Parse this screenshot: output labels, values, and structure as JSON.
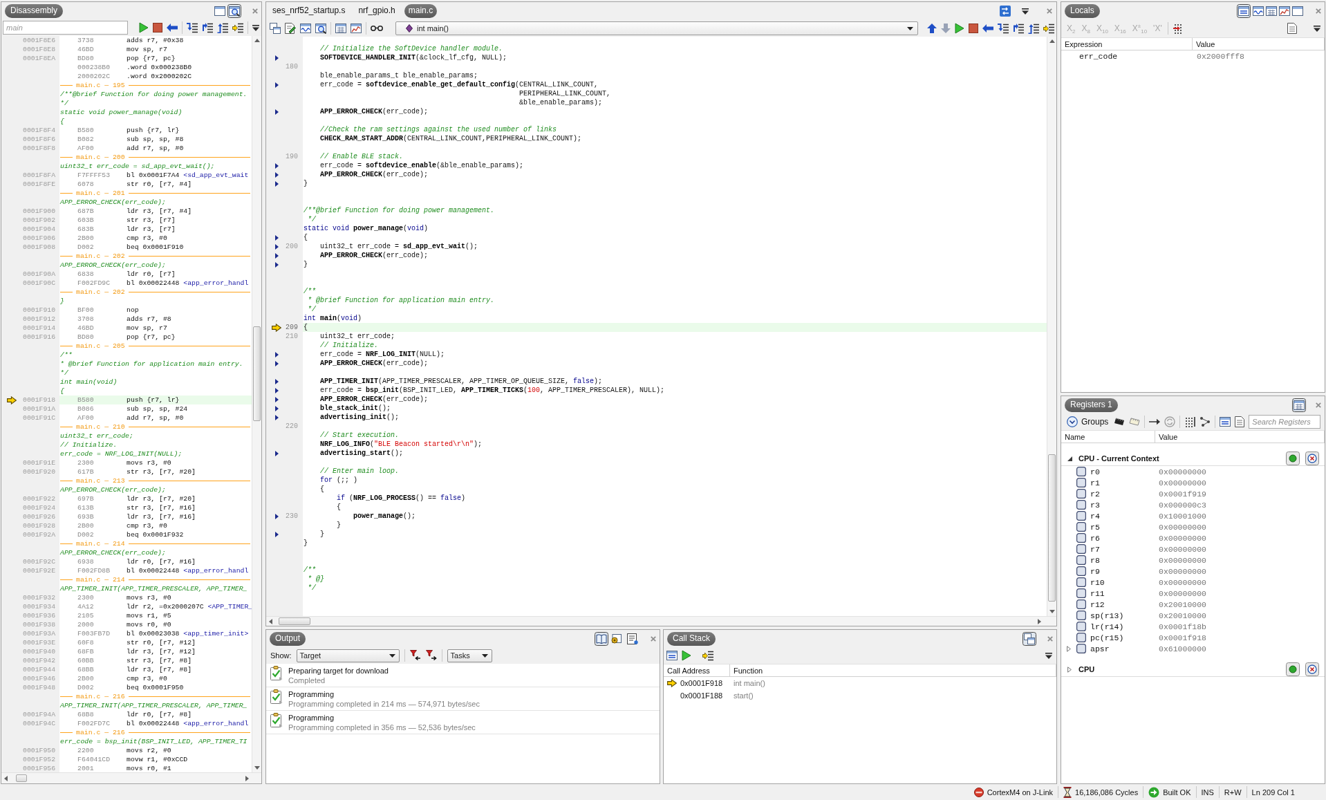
{
  "disassembly": {
    "title": "Disassembly",
    "location_field": {
      "placeholder": "main"
    },
    "rows": [
      {
        "kind": "instruction",
        "address": "0001F8E6",
        "opcode": "3738",
        "instruction": "adds r7, #0x38",
        "current": false
      },
      {
        "kind": "instruction",
        "address": "0001F8E8",
        "opcode": "46BD",
        "instruction": "mov sp, r7",
        "current": false
      },
      {
        "kind": "instruction",
        "address": "0001F8EA",
        "opcode": "BD80",
        "instruction": "pop {r7, pc}",
        "current": false
      },
      {
        "kind": "instruction",
        "opcode": "000238B0",
        "instruction": ".word 0x000238B0",
        "current": false
      },
      {
        "kind": "instruction",
        "opcode": "2000202C",
        "instruction": ".word 0x2000202C",
        "current": false
      },
      {
        "kind": "source_ref",
        "text": "main.c — 195"
      },
      {
        "kind": "source",
        "text": "/**@brief Function for doing power management."
      },
      {
        "kind": "source",
        "text": "*/"
      },
      {
        "kind": "source",
        "text": "static void power_manage(void)"
      },
      {
        "kind": "source",
        "text": "{"
      },
      {
        "kind": "instruction",
        "address": "0001F8F4",
        "opcode": "B580",
        "instruction": "push {r7, lr}",
        "current": false
      },
      {
        "kind": "instruction",
        "address": "0001F8F6",
        "opcode": "B082",
        "instruction": "sub sp, sp, #8",
        "current": false
      },
      {
        "kind": "instruction",
        "address": "0001F8F8",
        "opcode": "AF00",
        "instruction": "add r7, sp, #0",
        "current": false
      },
      {
        "kind": "source_ref",
        "text": "main.c — 200"
      },
      {
        "kind": "source",
        "text": "uint32_t err_code = sd_app_evt_wait();"
      },
      {
        "kind": "instruction",
        "address": "0001F8FA",
        "opcode": "F7FFFF53",
        "instruction": "bl 0x0001F7A4",
        "symbol": "<sd_app_evt_wait",
        "current": false
      },
      {
        "kind": "instruction",
        "address": "0001F8FE",
        "opcode": "6078",
        "instruction": "str r0, [r7, #4]",
        "current": false
      },
      {
        "kind": "source_ref",
        "text": "main.c — 201"
      },
      {
        "kind": "source",
        "text": "APP_ERROR_CHECK(err_code);"
      },
      {
        "kind": "instruction",
        "address": "0001F900",
        "opcode": "687B",
        "instruction": "ldr r3, [r7, #4]",
        "current": false
      },
      {
        "kind": "instruction",
        "address": "0001F902",
        "opcode": "603B",
        "instruction": "str r3, [r7]",
        "current": false
      },
      {
        "kind": "instruction",
        "address": "0001F904",
        "opcode": "683B",
        "instruction": "ldr r3, [r7]",
        "current": false
      },
      {
        "kind": "instruction",
        "address": "0001F906",
        "opcode": "2B00",
        "instruction": "cmp r3, #0",
        "current": false
      },
      {
        "kind": "instruction",
        "address": "0001F908",
        "opcode": "D002",
        "instruction": "beq 0x0001F910",
        "current": false
      },
      {
        "kind": "source_ref",
        "text": "main.c — 202"
      },
      {
        "kind": "source",
        "text": "APP_ERROR_CHECK(err_code);"
      },
      {
        "kind": "instruction",
        "address": "0001F90A",
        "opcode": "6838",
        "instruction": "ldr r0, [r7]",
        "current": false
      },
      {
        "kind": "instruction",
        "address": "0001F90C",
        "opcode": "F002FD9C",
        "instruction": "bl 0x00022448",
        "symbol": "<app_error_handl",
        "current": false
      },
      {
        "kind": "source_ref",
        "text": "main.c — 202"
      },
      {
        "kind": "source",
        "text": "}"
      },
      {
        "kind": "instruction",
        "address": "0001F910",
        "opcode": "BF00",
        "instruction": "nop",
        "current": false
      },
      {
        "kind": "instruction",
        "address": "0001F912",
        "opcode": "3708",
        "instruction": "adds r7, #8",
        "current": false
      },
      {
        "kind": "instruction",
        "address": "0001F914",
        "opcode": "46BD",
        "instruction": "mov sp, r7",
        "current": false
      },
      {
        "kind": "instruction",
        "address": "0001F916",
        "opcode": "BD80",
        "instruction": "pop {r7, pc}",
        "current": false
      },
      {
        "kind": "source_ref",
        "text": "main.c — 205"
      },
      {
        "kind": "source",
        "text": "/**"
      },
      {
        "kind": "source",
        "text": "* @brief Function for application main entry."
      },
      {
        "kind": "source",
        "text": "*/"
      },
      {
        "kind": "source",
        "text": "int main(void)"
      },
      {
        "kind": "source",
        "text": "{"
      },
      {
        "kind": "instruction",
        "address": "0001F918",
        "opcode": "B580",
        "instruction": "push {r7, lr}",
        "current": true
      },
      {
        "kind": "instruction",
        "address": "0001F91A",
        "opcode": "B086",
        "instruction": "sub sp, sp, #24",
        "current": false
      },
      {
        "kind": "instruction",
        "address": "0001F91C",
        "opcode": "AF00",
        "instruction": "add r7, sp, #0",
        "current": false
      },
      {
        "kind": "source_ref",
        "text": "main.c — 210"
      },
      {
        "kind": "source",
        "text": "uint32_t err_code;"
      },
      {
        "kind": "source",
        "text": "// Initialize."
      },
      {
        "kind": "source",
        "text": "err_code = NRF_LOG_INIT(NULL);"
      },
      {
        "kind": "instruction",
        "address": "0001F91E",
        "opcode": "2300",
        "instruction": "movs r3, #0",
        "current": false
      },
      {
        "kind": "instruction",
        "address": "0001F920",
        "opcode": "617B",
        "instruction": "str r3, [r7, #20]",
        "current": false
      },
      {
        "kind": "source_ref",
        "text": "main.c — 213"
      },
      {
        "kind": "source",
        "text": "APP_ERROR_CHECK(err_code);"
      },
      {
        "kind": "instruction",
        "address": "0001F922",
        "opcode": "697B",
        "instruction": "ldr r3, [r7, #20]",
        "current": false
      },
      {
        "kind": "instruction",
        "address": "0001F924",
        "opcode": "613B",
        "instruction": "str r3, [r7, #16]",
        "current": false
      },
      {
        "kind": "instruction",
        "address": "0001F926",
        "opcode": "693B",
        "instruction": "ldr r3, [r7, #16]",
        "current": false
      },
      {
        "kind": "instruction",
        "address": "0001F928",
        "opcode": "2B00",
        "instruction": "cmp r3, #0",
        "current": false
      },
      {
        "kind": "instruction",
        "address": "0001F92A",
        "opcode": "D002",
        "instruction": "beq 0x0001F932",
        "current": false
      },
      {
        "kind": "source_ref",
        "text": "main.c — 214"
      },
      {
        "kind": "source",
        "text": "APP_ERROR_CHECK(err_code);"
      },
      {
        "kind": "instruction",
        "address": "0001F92C",
        "opcode": "6938",
        "instruction": "ldr r0, [r7, #16]",
        "current": false
      },
      {
        "kind": "instruction",
        "address": "0001F92E",
        "opcode": "F002FD8B",
        "instruction": "bl 0x00022448",
        "symbol": "<app_error_handl",
        "current": false
      },
      {
        "kind": "source_ref",
        "text": "main.c — 214"
      },
      {
        "kind": "source",
        "text": "APP_TIMER_INIT(APP_TIMER_PRESCALER, APP_TIMER_"
      },
      {
        "kind": "instruction",
        "address": "0001F932",
        "opcode": "2300",
        "instruction": "movs r3, #0",
        "current": false
      },
      {
        "kind": "instruction",
        "address": "0001F934",
        "opcode": "4A12",
        "instruction": "ldr r2, =0x2000207C",
        "symbol": "<APP_TIMER_",
        "current": false
      },
      {
        "kind": "instruction",
        "address": "0001F936",
        "opcode": "2105",
        "instruction": "movs r1, #5",
        "current": false
      },
      {
        "kind": "instruction",
        "address": "0001F938",
        "opcode": "2000",
        "instruction": "movs r0, #0",
        "current": false
      },
      {
        "kind": "instruction",
        "address": "0001F93A",
        "opcode": "F003FB7D",
        "instruction": "bl 0x00023038",
        "symbol": "<app_timer_init>",
        "current": false
      },
      {
        "kind": "instruction",
        "address": "0001F93E",
        "opcode": "60F8",
        "instruction": "str r0, [r7, #12]",
        "current": false
      },
      {
        "kind": "instruction",
        "address": "0001F940",
        "opcode": "68FB",
        "instruction": "ldr r3, [r7, #12]",
        "current": false
      },
      {
        "kind": "instruction",
        "address": "0001F942",
        "opcode": "60BB",
        "instruction": "str r3, [r7, #8]",
        "current": false
      },
      {
        "kind": "instruction",
        "address": "0001F944",
        "opcode": "68BB",
        "instruction": "ldr r3, [r7, #8]",
        "current": false
      },
      {
        "kind": "instruction",
        "address": "0001F946",
        "opcode": "2B00",
        "instruction": "cmp r3, #0",
        "current": false
      },
      {
        "kind": "instruction",
        "address": "0001F948",
        "opcode": "D002",
        "instruction": "beq 0x0001F950",
        "current": false
      },
      {
        "kind": "source_ref",
        "text": "main.c — 216"
      },
      {
        "kind": "source",
        "text": "APP_TIMER_INIT(APP_TIMER_PRESCALER, APP_TIMER_"
      },
      {
        "kind": "instruction",
        "address": "0001F94A",
        "opcode": "68B8",
        "instruction": "ldr r0, [r7, #8]",
        "current": false
      },
      {
        "kind": "instruction",
        "address": "0001F94C",
        "opcode": "F002FD7C",
        "instruction": "bl 0x00022448",
        "symbol": "<app_error_handl",
        "current": false
      },
      {
        "kind": "source_ref",
        "text": "main.c — 216"
      },
      {
        "kind": "source",
        "text": "err_code = bsp_init(BSP_INIT_LED, APP_TIMER_TI"
      },
      {
        "kind": "instruction",
        "address": "0001F950",
        "opcode": "2200",
        "instruction": "movs r2, #0",
        "current": false
      },
      {
        "kind": "instruction",
        "address": "0001F952",
        "opcode": "F64041CD",
        "instruction": "movw r1, #0xCCD",
        "current": false
      },
      {
        "kind": "instruction",
        "address": "0001F956",
        "opcode": "2001",
        "instruction": "movs r0, #1",
        "current": false
      }
    ]
  },
  "editor": {
    "tabs": [
      {
        "label": "ses_nrf52_startup.s",
        "selected": false
      },
      {
        "label": "nrf_gpio.h",
        "selected": false
      },
      {
        "label": "main.c",
        "selected": true
      }
    ],
    "function_selector": {
      "value": "int main()"
    },
    "lines": [
      {
        "code_marker": false,
        "current": false,
        "parts": [
          {
            "kind": "comment",
            "text": "    // Initialize the SoftDevice handler module."
          }
        ]
      },
      {
        "code_marker": true,
        "current": false,
        "parts": [
          {
            "kind": "function",
            "text": "    SOFTDEVICE_HANDLER_INIT"
          },
          {
            "kind": "plain",
            "text": "(&clock_lf_cfg, NULL);"
          }
        ]
      },
      {
        "number": "180",
        "code_marker": false,
        "current": false
      },
      {
        "code_marker": false,
        "current": false,
        "parts": [
          {
            "kind": "plain",
            "text": "    ble_enable_params_t ble_enable_params;"
          }
        ]
      },
      {
        "code_marker": true,
        "current": false,
        "parts": [
          {
            "kind": "plain",
            "text": "    err_code = "
          },
          {
            "kind": "function",
            "text": "softdevice_enable_get_default_config"
          },
          {
            "kind": "plain",
            "text": "(CENTRAL_LINK_COUNT,"
          }
        ]
      },
      {
        "code_marker": false,
        "current": false,
        "parts": [
          {
            "kind": "plain",
            "text": "                                                    PERIPHERAL_LINK_COUNT,"
          }
        ]
      },
      {
        "code_marker": false,
        "current": false,
        "parts": [
          {
            "kind": "plain",
            "text": "                                                    &ble_enable_params);"
          }
        ]
      },
      {
        "code_marker": true,
        "current": false,
        "parts": [
          {
            "kind": "function",
            "text": "    APP_ERROR_CHECK"
          },
          {
            "kind": "plain",
            "text": "(err_code);"
          }
        ]
      },
      {
        "code_marker": false,
        "current": false
      },
      {
        "code_marker": false,
        "current": false,
        "parts": [
          {
            "kind": "comment",
            "text": "    //Check the ram settings against the used number of links"
          }
        ]
      },
      {
        "code_marker": false,
        "current": false,
        "parts": [
          {
            "kind": "function",
            "text": "    CHECK_RAM_START_ADDR"
          },
          {
            "kind": "plain",
            "text": "(CENTRAL_LINK_COUNT,PERIPHERAL_LINK_COUNT);"
          }
        ]
      },
      {
        "code_marker": false,
        "current": false
      },
      {
        "number": "190",
        "code_marker": false,
        "current": false,
        "parts": [
          {
            "kind": "comment",
            "text": "    // Enable BLE stack."
          }
        ]
      },
      {
        "code_marker": true,
        "current": false,
        "parts": [
          {
            "kind": "plain",
            "text": "    err_code = "
          },
          {
            "kind": "function",
            "text": "softdevice_enable"
          },
          {
            "kind": "plain",
            "text": "(&ble_enable_params);"
          }
        ]
      },
      {
        "code_marker": true,
        "current": false,
        "parts": [
          {
            "kind": "function",
            "text": "    APP_ERROR_CHECK"
          },
          {
            "kind": "plain",
            "text": "(err_code);"
          }
        ]
      },
      {
        "code_marker": true,
        "current": false,
        "parts": [
          {
            "kind": "plain",
            "text": "}"
          }
        ]
      },
      {
        "code_marker": false,
        "current": false
      },
      {
        "code_marker": false,
        "current": false
      },
      {
        "code_marker": false,
        "current": false,
        "parts": [
          {
            "kind": "comment",
            "text": "/**@brief Function for doing power management."
          }
        ]
      },
      {
        "code_marker": false,
        "current": false,
        "parts": [
          {
            "kind": "comment",
            "text": " */"
          }
        ]
      },
      {
        "code_marker": false,
        "current": false,
        "parts": [
          {
            "kind": "keyword",
            "text": "static void "
          },
          {
            "kind": "function",
            "text": "power_manage"
          },
          {
            "kind": "plain",
            "text": "("
          },
          {
            "kind": "keyword",
            "text": "void"
          },
          {
            "kind": "plain",
            "text": ")"
          }
        ]
      },
      {
        "code_marker": true,
        "current": false,
        "parts": [
          {
            "kind": "plain",
            "text": "{"
          }
        ]
      },
      {
        "number": "200",
        "code_marker": true,
        "current": false,
        "parts": [
          {
            "kind": "plain",
            "text": "    uint32_t err_code = "
          },
          {
            "kind": "function",
            "text": "sd_app_evt_wait"
          },
          {
            "kind": "plain",
            "text": "();"
          }
        ]
      },
      {
        "code_marker": true,
        "current": false,
        "parts": [
          {
            "kind": "function",
            "text": "    APP_ERROR_CHECK"
          },
          {
            "kind": "plain",
            "text": "(err_code);"
          }
        ]
      },
      {
        "code_marker": true,
        "current": false,
        "parts": [
          {
            "kind": "plain",
            "text": "}"
          }
        ]
      },
      {
        "code_marker": false,
        "current": false
      },
      {
        "code_marker": false,
        "current": false
      },
      {
        "code_marker": false,
        "current": false,
        "parts": [
          {
            "kind": "comment",
            "text": "/**"
          }
        ]
      },
      {
        "code_marker": false,
        "current": false,
        "parts": [
          {
            "kind": "comment",
            "text": " * @brief Function for application main entry."
          }
        ]
      },
      {
        "code_marker": false,
        "current": false,
        "parts": [
          {
            "kind": "comment",
            "text": " */"
          }
        ]
      },
      {
        "code_marker": false,
        "current": false,
        "parts": [
          {
            "kind": "keyword",
            "text": "int "
          },
          {
            "kind": "function",
            "text": "main"
          },
          {
            "kind": "plain",
            "text": "("
          },
          {
            "kind": "keyword",
            "text": "void"
          },
          {
            "kind": "plain",
            "text": ")"
          }
        ]
      },
      {
        "number": "209",
        "code_marker": false,
        "current": true,
        "parts": [
          {
            "kind": "plain",
            "text": "{"
          }
        ]
      },
      {
        "number": "210",
        "code_marker": false,
        "current": false,
        "parts": [
          {
            "kind": "plain",
            "text": "    uint32_t err_code;"
          }
        ]
      },
      {
        "code_marker": false,
        "current": false,
        "parts": [
          {
            "kind": "comment",
            "text": "    // Initialize."
          }
        ]
      },
      {
        "code_marker": true,
        "current": false,
        "parts": [
          {
            "kind": "plain",
            "text": "    err_code = "
          },
          {
            "kind": "function",
            "text": "NRF_LOG_INIT"
          },
          {
            "kind": "plain",
            "text": "(NULL);"
          }
        ]
      },
      {
        "code_marker": true,
        "current": false,
        "parts": [
          {
            "kind": "function",
            "text": "    APP_ERROR_CHECK"
          },
          {
            "kind": "plain",
            "text": "(err_code);"
          }
        ]
      },
      {
        "code_marker": false,
        "current": false
      },
      {
        "code_marker": true,
        "current": false,
        "parts": [
          {
            "kind": "function",
            "text": "    APP_TIMER_INIT"
          },
          {
            "kind": "plain",
            "text": "(APP_TIMER_PRESCALER, APP_TIMER_OP_QUEUE_SIZE, "
          },
          {
            "kind": "keyword",
            "text": "false"
          },
          {
            "kind": "plain",
            "text": ");"
          }
        ]
      },
      {
        "code_marker": true,
        "current": false,
        "parts": [
          {
            "kind": "plain",
            "text": "    err_code = "
          },
          {
            "kind": "function",
            "text": "bsp_init"
          },
          {
            "kind": "plain",
            "text": "(BSP_INIT_LED, "
          },
          {
            "kind": "function",
            "text": "APP_TIMER_TICKS"
          },
          {
            "kind": "plain",
            "text": "("
          },
          {
            "kind": "number",
            "text": "100"
          },
          {
            "kind": "plain",
            "text": ", APP_TIMER_PRESCALER), NULL);"
          }
        ]
      },
      {
        "code_marker": true,
        "current": false,
        "parts": [
          {
            "kind": "function",
            "text": "    APP_ERROR_CHECK"
          },
          {
            "kind": "plain",
            "text": "(err_code);"
          }
        ]
      },
      {
        "code_marker": true,
        "current": false,
        "parts": [
          {
            "kind": "function",
            "text": "    ble_stack_init"
          },
          {
            "kind": "plain",
            "text": "();"
          }
        ]
      },
      {
        "code_marker": true,
        "current": false,
        "parts": [
          {
            "kind": "function",
            "text": "    advertising_init"
          },
          {
            "kind": "plain",
            "text": "();"
          }
        ]
      },
      {
        "number": "220",
        "code_marker": false,
        "current": false
      },
      {
        "code_marker": false,
        "current": false,
        "parts": [
          {
            "kind": "comment",
            "text": "    // Start execution."
          }
        ]
      },
      {
        "code_marker": false,
        "current": false,
        "parts": [
          {
            "kind": "function",
            "text": "    NRF_LOG_INFO"
          },
          {
            "kind": "plain",
            "text": "("
          },
          {
            "kind": "string",
            "text": "\"BLE Beacon started\\r\\n\""
          },
          {
            "kind": "plain",
            "text": ");"
          }
        ]
      },
      {
        "code_marker": true,
        "current": false,
        "parts": [
          {
            "kind": "function",
            "text": "    advertising_start"
          },
          {
            "kind": "plain",
            "text": "();"
          }
        ]
      },
      {
        "code_marker": false,
        "current": false
      },
      {
        "code_marker": false,
        "current": false,
        "parts": [
          {
            "kind": "comment",
            "text": "    // Enter main loop."
          }
        ]
      },
      {
        "code_marker": false,
        "current": false,
        "parts": [
          {
            "kind": "keyword",
            "text": "    for"
          },
          {
            "kind": "plain",
            "text": " (;; )"
          }
        ]
      },
      {
        "code_marker": false,
        "current": false,
        "parts": [
          {
            "kind": "plain",
            "text": "    {"
          }
        ]
      },
      {
        "code_marker": false,
        "current": false,
        "parts": [
          {
            "kind": "keyword",
            "text": "        if"
          },
          {
            "kind": "plain",
            "text": " ("
          },
          {
            "kind": "function",
            "text": "NRF_LOG_PROCESS"
          },
          {
            "kind": "plain",
            "text": "() == "
          },
          {
            "kind": "keyword",
            "text": "false"
          },
          {
            "kind": "plain",
            "text": ")"
          }
        ]
      },
      {
        "code_marker": false,
        "current": false,
        "parts": [
          {
            "kind": "plain",
            "text": "        {"
          }
        ]
      },
      {
        "number": "230",
        "code_marker": true,
        "current": false,
        "parts": [
          {
            "kind": "function",
            "text": "            power_manage"
          },
          {
            "kind": "plain",
            "text": "();"
          }
        ]
      },
      {
        "code_marker": false,
        "current": false,
        "parts": [
          {
            "kind": "plain",
            "text": "        }"
          }
        ]
      },
      {
        "code_marker": true,
        "current": false,
        "parts": [
          {
            "kind": "plain",
            "text": "    }"
          }
        ]
      },
      {
        "code_marker": false,
        "current": false,
        "parts": [
          {
            "kind": "plain",
            "text": "}"
          }
        ]
      },
      {
        "code_marker": false,
        "current": false
      },
      {
        "code_marker": false,
        "current": false
      },
      {
        "code_marker": false,
        "current": false,
        "parts": [
          {
            "kind": "comment",
            "text": "/**"
          }
        ]
      },
      {
        "code_marker": false,
        "current": false,
        "parts": [
          {
            "kind": "comment",
            "text": " * @}"
          }
        ]
      },
      {
        "code_marker": false,
        "current": false,
        "parts": [
          {
            "kind": "comment",
            "text": " */"
          }
        ]
      }
    ]
  },
  "output": {
    "title": "Output",
    "show_label": "Show:",
    "show_select": {
      "value": "Target"
    },
    "tasks_select": {
      "value": "Tasks"
    },
    "entries": [
      {
        "title": "Preparing target for download",
        "detail": "Completed"
      },
      {
        "title": "Programming",
        "detail": "Programming completed in 214 ms — 574,971 bytes/sec"
      },
      {
        "title": "Programming",
        "detail": "Programming completed in 356 ms — 52,536 bytes/sec"
      }
    ]
  },
  "call_stack": {
    "title": "Call Stack",
    "columns": [
      "Call Address",
      "Function"
    ],
    "rows": [
      {
        "address": "0x0001F918",
        "function": "int main()",
        "current": true
      },
      {
        "address": "0x0001F188",
        "function": "start()",
        "current": false
      }
    ]
  },
  "locals": {
    "title": "Locals",
    "format_buttons": [
      {
        "label": "X$_{2}$",
        "disabled": true
      },
      {
        "label": "X$_{8}$",
        "disabled": true
      },
      {
        "label": "X$_{10}$",
        "disabled": true
      },
      {
        "label": "X$_{16}$",
        "disabled": true
      },
      {
        "label": "X$^{±}$$_{10}$",
        "disabled": true
      },
      {
        "label": "'X'",
        "disabled": true
      }
    ],
    "columns": [
      "Expression",
      "Value"
    ],
    "rows": [
      {
        "expression": "err_code",
        "value": "0x2000fff8"
      }
    ]
  },
  "registers": {
    "title": "Registers 1",
    "groups_button": "Groups",
    "search": {
      "placeholder": "Search Registers"
    },
    "columns": [
      "Name",
      "Value"
    ],
    "groups": [
      {
        "name": "CPU - Current Context",
        "expanded": true,
        "registers": [
          {
            "name": "r0",
            "value": "0x00000000",
            "expandable": false
          },
          {
            "name": "r1",
            "value": "0x00000000",
            "expandable": false
          },
          {
            "name": "r2",
            "value": "0x0001f919",
            "expandable": false
          },
          {
            "name": "r3",
            "value": "0x000000c3",
            "expandable": false
          },
          {
            "name": "r4",
            "value": "0x10001000",
            "expandable": false
          },
          {
            "name": "r5",
            "value": "0x00000000",
            "expandable": false
          },
          {
            "name": "r6",
            "value": "0x00000000",
            "expandable": false
          },
          {
            "name": "r7",
            "value": "0x00000000",
            "expandable": false
          },
          {
            "name": "r8",
            "value": "0x00000000",
            "expandable": false
          },
          {
            "name": "r9",
            "value": "0x00000000",
            "expandable": false
          },
          {
            "name": "r10",
            "value": "0x00000000",
            "expandable": false
          },
          {
            "name": "r11",
            "value": "0x00000000",
            "expandable": false
          },
          {
            "name": "r12",
            "value": "0x20010000",
            "expandable": false
          },
          {
            "name": "sp(r13)",
            "value": "0x20010000",
            "expandable": false
          },
          {
            "name": "lr(r14)",
            "value": "0x0001f18b",
            "expandable": false
          },
          {
            "name": "pc(r15)",
            "value": "0x0001f918",
            "expandable": false
          },
          {
            "name": "apsr",
            "value": "0x61000000",
            "expandable": true
          }
        ]
      },
      {
        "name": "CPU",
        "expanded": false
      }
    ]
  },
  "status_bar": {
    "items": [
      {
        "kind": "connection",
        "text": "CortexM4 on J-Link"
      },
      {
        "kind": "cycles",
        "text": "16,186,086 Cycles"
      },
      {
        "kind": "build",
        "text": "Built OK"
      },
      {
        "kind": "plain",
        "text": "INS"
      },
      {
        "kind": "plain",
        "text": "R+W"
      },
      {
        "kind": "plain",
        "text": "Ln 209 Col 1"
      }
    ]
  }
}
